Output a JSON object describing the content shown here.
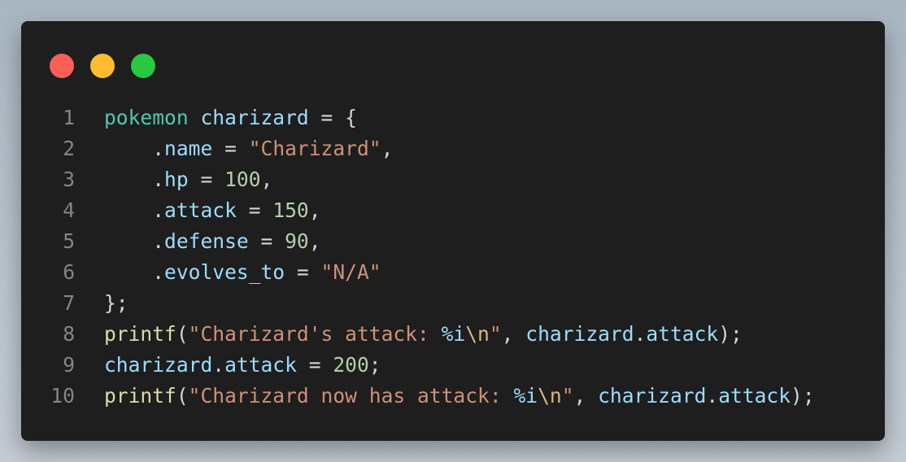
{
  "window": {
    "controls": [
      {
        "name": "close",
        "color": "#ff5f57"
      },
      {
        "name": "minimize",
        "color": "#febc2e"
      },
      {
        "name": "maximize",
        "color": "#28c840"
      }
    ]
  },
  "colors": {
    "background": "#1e1e1e",
    "type": "#4ec9b0",
    "variable": "#9cdcfe",
    "string": "#ce9178",
    "number": "#b5cea8",
    "function": "#dcdcaa",
    "escape": "#d7ba7d",
    "line_number": "#858585"
  },
  "code": {
    "lines": [
      {
        "n": "1",
        "tokens": [
          {
            "t": "pokemon",
            "c": "type"
          },
          {
            "t": " ",
            "c": "punc"
          },
          {
            "t": "charizard",
            "c": "var"
          },
          {
            "t": " = {",
            "c": "punc"
          }
        ]
      },
      {
        "n": "2",
        "tokens": [
          {
            "t": "    .",
            "c": "punc"
          },
          {
            "t": "name",
            "c": "var"
          },
          {
            "t": " = ",
            "c": "punc"
          },
          {
            "t": "\"Charizard\"",
            "c": "str"
          },
          {
            "t": ",",
            "c": "punc"
          }
        ]
      },
      {
        "n": "3",
        "tokens": [
          {
            "t": "    .",
            "c": "punc"
          },
          {
            "t": "hp",
            "c": "var"
          },
          {
            "t": " = ",
            "c": "punc"
          },
          {
            "t": "100",
            "c": "num"
          },
          {
            "t": ",",
            "c": "punc"
          }
        ]
      },
      {
        "n": "4",
        "tokens": [
          {
            "t": "    .",
            "c": "punc"
          },
          {
            "t": "attack",
            "c": "var"
          },
          {
            "t": " = ",
            "c": "punc"
          },
          {
            "t": "150",
            "c": "num"
          },
          {
            "t": ",",
            "c": "punc"
          }
        ]
      },
      {
        "n": "5",
        "tokens": [
          {
            "t": "    .",
            "c": "punc"
          },
          {
            "t": "defense",
            "c": "var"
          },
          {
            "t": " = ",
            "c": "punc"
          },
          {
            "t": "90",
            "c": "num"
          },
          {
            "t": ",",
            "c": "punc"
          }
        ]
      },
      {
        "n": "6",
        "tokens": [
          {
            "t": "    .",
            "c": "punc"
          },
          {
            "t": "evolves_to",
            "c": "var"
          },
          {
            "t": " = ",
            "c": "punc"
          },
          {
            "t": "\"N/A\"",
            "c": "str"
          }
        ]
      },
      {
        "n": "7",
        "tokens": [
          {
            "t": "};",
            "c": "punc"
          }
        ]
      },
      {
        "n": "8",
        "tokens": [
          {
            "t": "printf",
            "c": "fn"
          },
          {
            "t": "(",
            "c": "punc"
          },
          {
            "t": "\"Charizard's attack: ",
            "c": "str"
          },
          {
            "t": "%i",
            "c": "var"
          },
          {
            "t": "\\n",
            "c": "esc"
          },
          {
            "t": "\"",
            "c": "str"
          },
          {
            "t": ", ",
            "c": "punc"
          },
          {
            "t": "charizard",
            "c": "var"
          },
          {
            "t": ".",
            "c": "punc"
          },
          {
            "t": "attack",
            "c": "var"
          },
          {
            "t": ");",
            "c": "punc"
          }
        ]
      },
      {
        "n": "9",
        "tokens": [
          {
            "t": "charizard",
            "c": "var"
          },
          {
            "t": ".",
            "c": "punc"
          },
          {
            "t": "attack",
            "c": "var"
          },
          {
            "t": " = ",
            "c": "punc"
          },
          {
            "t": "200",
            "c": "num"
          },
          {
            "t": ";",
            "c": "punc"
          }
        ]
      },
      {
        "n": "10",
        "tokens": [
          {
            "t": "printf",
            "c": "fn"
          },
          {
            "t": "(",
            "c": "punc"
          },
          {
            "t": "\"Charizard now has attack: ",
            "c": "str"
          },
          {
            "t": "%i",
            "c": "var"
          },
          {
            "t": "\\n",
            "c": "esc"
          },
          {
            "t": "\"",
            "c": "str"
          },
          {
            "t": ", ",
            "c": "punc"
          },
          {
            "t": "charizard",
            "c": "var"
          },
          {
            "t": ".",
            "c": "punc"
          },
          {
            "t": "attack",
            "c": "var"
          },
          {
            "t": ");",
            "c": "punc"
          }
        ]
      }
    ]
  }
}
